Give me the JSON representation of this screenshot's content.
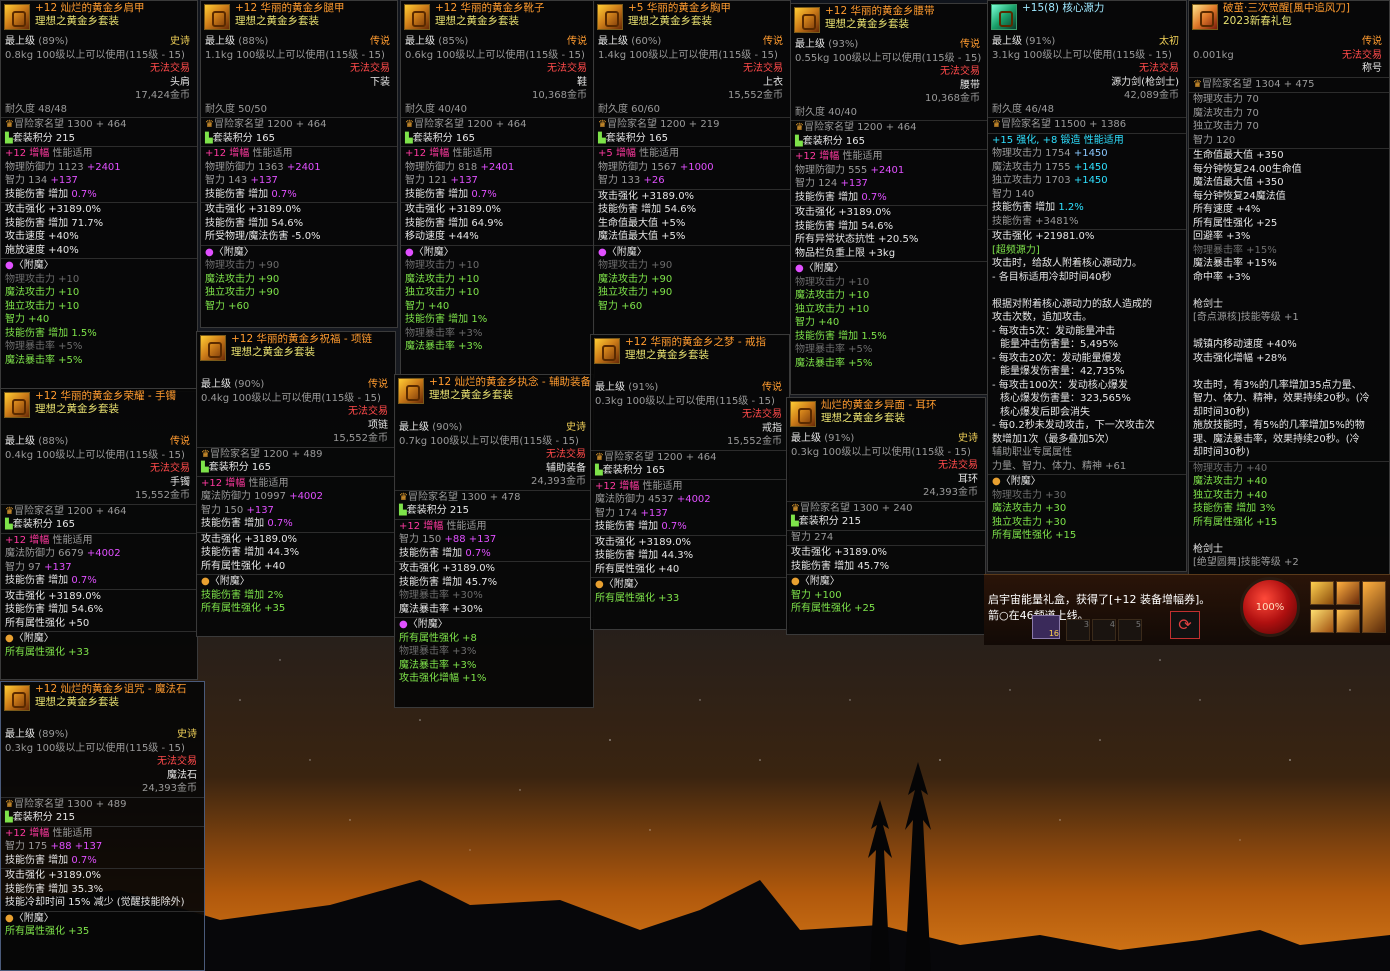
{
  "colors": {
    "legend": "#ff9b2f",
    "epic": "#e8e070",
    "untradeable": "#ff4a4a",
    "enchant": "#7ee34a",
    "amp": "#ff3aa0"
  },
  "common": {
    "max_level": "最上级",
    "untradeable": "无法交易",
    "title_prefix": "冒险家名望",
    "set_points": "套装积分",
    "amp": "增幅",
    "perf": "性能适用",
    "attack_boost": "攻击强化",
    "skill_dmg": "技能伤害 增加",
    "enchant": "〈附魔〉"
  },
  "cards": {
    "shoulder": {
      "title": "+12 灿烂的黄金乡肩甲",
      "set": "理想之黄金乡套装",
      "pct": "(89%)",
      "grade": "史诗",
      "weight": "0.8kg",
      "req": "100级以上可以使用(115级 - 15)",
      "slot": "头肩",
      "price": "17,424金币",
      "dura": "耐久度 48/48",
      "fame": "1300 + 464",
      "setpts": "215",
      "amp_line": "+12",
      "amp_stat": "物理防御力 1123",
      "amp_bonus": "+2401",
      "int": "智力 134",
      "int_b": "+137",
      "sd": "0.7%",
      "ab": "+3189.0%",
      "sd2": "71.7%",
      "l3": "攻击速度 +40%",
      "l4": "施放速度 +40%",
      "e1": "物理攻击力 +10",
      "e2": "魔法攻击力 +10",
      "e3": "独立攻击力 +10",
      "e4": "智力 +40",
      "e5": "1.5%",
      "e6": "物理暴击率 +5%",
      "e7": "魔法暴击率 +5%"
    },
    "pants": {
      "title": "+12 华丽的黄金乡腿甲",
      "set": "理想之黄金乡套装",
      "pct": "(88%)",
      "grade": "传说",
      "weight": "1.1kg",
      "req": "100级以上可以使用(115级 - 15)",
      "slot": "下装",
      "dura": "耐久度 50/50",
      "fame": "1200 + 464",
      "setpts": "165",
      "amp_stat": "物理防御力 1363",
      "amp_bonus": "+2401",
      "int": "智力 143",
      "int_b": "+137",
      "sd": "0.7%",
      "ab": "+3189.0%",
      "sd2": "54.6%",
      "l3": "所受物理/魔法伤害 -5.0%",
      "e1": "物理攻击力 +90",
      "e2": "魔法攻击力 +90",
      "e3": "独立攻击力 +90",
      "e4": "智力 +60"
    },
    "shoes": {
      "title": "+12 华丽的黄金乡靴子",
      "set": "理想之黄金乡套装",
      "pct": "(85%)",
      "grade": "传说",
      "weight": "0.6kg",
      "req": "100级以上可以使用(115级 - 15)",
      "slot": "鞋",
      "price": "10,368金币",
      "dura": "耐久度 40/40",
      "fame": "1200 + 464",
      "setpts": "165",
      "amp_stat": "物理防御力 818",
      "amp_bonus": "+2401",
      "int": "智力 121",
      "int_b": "+137",
      "sd": "0.7%",
      "ab": "+3189.0%",
      "sd2": "64.9%",
      "l3": "移动速度 +44%",
      "e1": "物理攻击力 +10",
      "e2": "魔法攻击力 +10",
      "e3": "独立攻击力 +10",
      "e4": "智力 +40",
      "e5": "1%",
      "e6": "物理暴击率 +3%",
      "e7": "魔法暴击率 +3%"
    },
    "chest": {
      "title": "+5 华丽的黄金乡胸甲",
      "set": "理想之黄金乡套装",
      "pct": "(60%)",
      "grade": "传说",
      "weight": "1.4kg",
      "req": "100级以上可以使用(115级 - 15)",
      "slot": "上衣",
      "price": "15,552金币",
      "dura": "耐久度 60/60",
      "fame": "1200 + 219",
      "setpts": "165",
      "amp_line": "+5",
      "amp_stat": "物理防御力 1567",
      "amp_bonus": "+1000",
      "int": "智力 133",
      "int_b": "+26",
      "ab": "+3189.0%",
      "sd2": "54.6%",
      "l3": "生命值最大值 +5%",
      "l4": "魔法值最大值 +5%",
      "e1": "物理攻击力 +90",
      "e2": "魔法攻击力 +90",
      "e3": "独立攻击力 +90",
      "e4": "智力 +60"
    },
    "belt": {
      "title": "+12 华丽的黄金乡腰带",
      "set": "理想之黄金乡套装",
      "pct": "(93%)",
      "grade": "传说",
      "weight": "0.55kg",
      "req": "100级以上可以使用(115级 - 15)",
      "slot": "腰带",
      "price": "10,368金币",
      "dura": "耐久度 40/40",
      "fame": "1200 + 464",
      "setpts": "165",
      "amp_stat": "物理防御力 555",
      "amp_bonus": "+2401",
      "int": "智力 124",
      "int_b": "+137",
      "sd": "0.7%",
      "ab": "+3189.0%",
      "sd2": "54.6%",
      "l3": "所有异常状态抗性 +20.5%",
      "l4": "物品栏负重上限 +3kg",
      "e1": "物理攻击力 +10",
      "e2": "魔法攻击力 +10",
      "e3": "独立攻击力 +10",
      "e4": "智力 +40",
      "e5": "1.5%",
      "e6": "物理暴击率 +5%",
      "e7": "魔法暴击率 +5%"
    },
    "core": {
      "title": "+15(8) 核心源力",
      "pct": "(91%)",
      "grade": "太初",
      "weight": "3.1kg",
      "req": "100级以上可以使用(115级 - 15)",
      "slot": "源力剑(枪剑士)",
      "price": "42,089金币",
      "dura": "耐久度 46/48",
      "fame": "11500 + 1386",
      "forge": "+15 强化, +8 锻造 性能适用",
      "s1": "物理攻击力 1754",
      "s1b": "+1450",
      "s2": "魔法攻击力 1755",
      "s2b": "+1450",
      "s3": "独立攻击力 1703",
      "s3b": "+1450",
      "s4": "智力 140",
      "sd": "1.2%",
      "s6": "技能伤害 +3481%",
      "ab": "+21981.0%",
      "ul": "[超频源力]",
      "d1": "攻击时，给敌人附着核心源动力。",
      "d2": "- 各目标适用冷却时间40秒",
      "d3": "根据对附着核心源动力的敌人造成的",
      "d4": "攻击次数，追加攻击。",
      "d5": "- 每攻击5次：发动能量冲击",
      "d6": "能量冲击伤害量：5,495%",
      "d7": "- 每攻击20次：发动能量爆发",
      "d8": "能量爆发伤害量：42,735%",
      "d9": "- 每攻击100次：发动核心爆发",
      "d10": "核心爆发伤害量：323,565%",
      "d11": "核心爆发后即会消失",
      "d12": "- 每0.2秒未发动攻击，下一次攻击次",
      "d13": "数增加1次（最多叠加5次）",
      "d14": "辅助职业专属属性",
      "d15": "力量、智力、体力、精神 +61",
      "e1": "物理攻击力 +30",
      "e2": "魔法攻击力 +30",
      "e3": "独立攻击力 +30",
      "e4": "所有属性强化 +15"
    },
    "gift": {
      "title": "破茧·三次觉醒[風中追风刀]",
      "sub": "2023新春礼包",
      "grade": "传说",
      "weight": "0.001kg",
      "slot": "称号",
      "fame": "1304 + 475",
      "s1": "物理攻击力 70",
      "s2": "魔法攻击力 70",
      "s3": "独立攻击力 70",
      "s4": "智力 120",
      "s5": "生命值最大值 +350",
      "s6": "每分钟恢复24.00生命值",
      "s7": "魔法值最大值 +350",
      "s8": "每分钟恢复24魔法值",
      "s9": "所有速度 +4%",
      "s10": "所有属性强化 +25",
      "s11": "回避率 +3%",
      "s12": "物理暴击率 +15%",
      "s13": "魔法暴击率 +15%",
      "s14": "命中率 +3%",
      "s15": "枪剑士",
      "s16": "[奇点源核]技能等级 +1",
      "s17": "城镇内移动速度 +40%",
      "s18": "攻击强化增幅 +28%",
      "s19": "攻击时，有3%的几率增加35点力量、",
      "s20": "智力、体力、精神，效果持续20秒。(冷",
      "s21": "却时间30秒)",
      "s22": "施放技能时，有5%的几率增加5%的物",
      "s23": "理、魔法暴击率，效果持续20秒。(冷",
      "s24": "却时间30秒)",
      "e1": "物理攻击力 +40",
      "e2": "魔法攻击力 +40",
      "e3": "独立攻击力 +40",
      "e4": "技能伤害 增加 3%",
      "e5": "所有属性强化 +15",
      "s25": "枪剑士",
      "s26": "[绝望圆舞]技能等级 +2"
    },
    "neck": {
      "title": "+12 华丽的黄金乡祝福 - 项链",
      "set": "理想之黄金乡套装",
      "pct": "(90%)",
      "grade": "传说",
      "weight": "0.4kg",
      "req": "100级以上可以使用(115级 - 15)",
      "slot": "项链",
      "price": "15,552金币",
      "fame": "1200 + 489",
      "setpts": "165",
      "amp_stat": "魔法防御力 10997",
      "amp_bonus": "+4002",
      "int": "智力 150",
      "int_b": "+137",
      "sd": "0.7%",
      "ab": "+3189.0%",
      "sd2": "44.3%",
      "l3": "所有属性强化 +40",
      "e1": "2%",
      "e2": "所有属性强化 +35"
    },
    "support": {
      "title": "+12 灿烂的黄金乡执念 - 辅助装备",
      "set": "理想之黄金乡套装",
      "pct": "(90%)",
      "grade": "史诗",
      "weight": "0.7kg",
      "req": "100级以上可以使用(115级 - 15)",
      "slot": "辅助装备",
      "price": "24,393金币",
      "fame": "1300 + 478",
      "setpts": "215",
      "int": "智力 150",
      "int_b": "+88 +137",
      "sd": "0.7%",
      "ab": "+3189.0%",
      "sd2": "45.7%",
      "l3": "物理暴击率 +30%",
      "l4": "魔法暴击率 +30%",
      "e1": "所有属性强化 +8",
      "e2": "物理暴击率 +3%",
      "e3": "魔法暴击率 +3%",
      "e4": "攻击强化增幅 +1%"
    },
    "ring": {
      "title": "+12 华丽的黄金乡之梦 - 戒指",
      "set": "理想之黄金乡套装",
      "pct": "(91%)",
      "grade": "传说",
      "weight": "0.3kg",
      "req": "100级以上可以使用(115级 - 15)",
      "slot": "戒指",
      "price": "15,552金币",
      "fame": "1200 + 464",
      "setpts": "165",
      "amp_stat": "魔法防御力 4537",
      "amp_bonus": "+4002",
      "int": "智力 174",
      "int_b": "+137",
      "sd": "0.7%",
      "ab": "+3189.0%",
      "sd2": "44.3%",
      "l3": "所有属性强化 +40",
      "e1": "所有属性强化 +33"
    },
    "earring": {
      "title": "灿烂的黄金乡异面 - 耳环",
      "set": "理想之黄金乡套装",
      "pct": "(91%)",
      "grade": "史诗",
      "weight": "0.3kg",
      "req": "100级以上可以使用(115级 - 15)",
      "slot": "耳环",
      "price": "24,393金币",
      "fame": "1300 + 240",
      "setpts": "215",
      "int": "智力 274",
      "ab": "+3189.0%",
      "sd2": "45.7%",
      "e1": "智力 +100",
      "e2": "所有属性强化 +25"
    },
    "bracelet": {
      "title": "+12 华丽的黄金乡荣耀 - 手镯",
      "set": "理想之黄金乡套装",
      "pct": "(88%)",
      "grade": "传说",
      "weight": "0.4kg",
      "req": "100级以上可以使用(115级 - 15)",
      "slot": "手镯",
      "price": "15,552金币",
      "fame": "1200 + 464",
      "setpts": "165",
      "amp_stat": "魔法防御力 6679",
      "amp_bonus": "+4002",
      "int": "智力 97",
      "int_b": "+137",
      "sd": "0.7%",
      "ab": "+3189.0%",
      "sd2": "54.6%",
      "l3": "所有属性强化 +50",
      "e1": "所有属性强化 +33"
    },
    "magicstone": {
      "title": "+12 灿烂的黄金乡诅咒 - 魔法石",
      "set": "理想之黄金乡套装",
      "pct": "(89%)",
      "grade": "史诗",
      "weight": "0.3kg",
      "req": "100级以上可以使用(115级 - 15)",
      "slot": "魔法石",
      "price": "24,393金币",
      "fame": "1300 + 489",
      "setpts": "215",
      "int": "智力 175",
      "int_b": "+88 +137",
      "sd": "0.7%",
      "ab": "+3189.0%",
      "sd2": "35.3%",
      "l3": "技能冷却时间 15% 减少 (觉醒技能除外)",
      "e1": "所有属性强化 +35"
    }
  },
  "hud": {
    "notice1": "启宇宙能量礼盒，获得了[+12 装备增幅券]。",
    "notice2": "箭○在46频道上线。",
    "hp": "100%",
    "slots": [
      "3",
      "4",
      "5"
    ],
    "badge": "16"
  }
}
